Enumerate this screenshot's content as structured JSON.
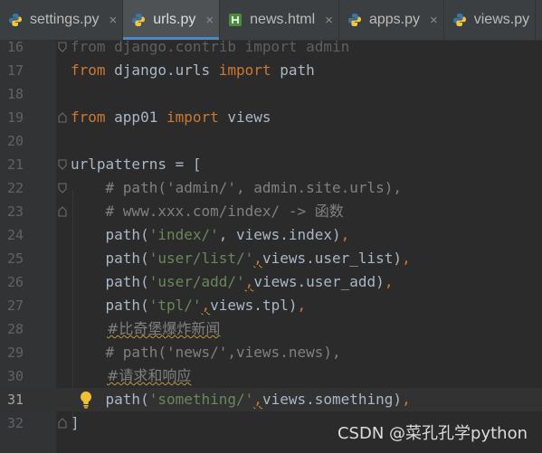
{
  "tabs": [
    {
      "label": "settings.py",
      "icon": "python-file-icon",
      "active": false
    },
    {
      "label": "urls.py",
      "icon": "python-file-icon",
      "active": true
    },
    {
      "label": "news.html",
      "icon": "html-file-icon",
      "active": false
    },
    {
      "label": "apps.py",
      "icon": "python-file-icon",
      "active": false
    },
    {
      "label": "views.py",
      "icon": "python-file-icon",
      "active": false
    }
  ],
  "tab_close_glyph": "×",
  "current_line": "31",
  "lines": {
    "l16": {
      "num": "16",
      "a": "from django.contrib import admin"
    },
    "l17": {
      "num": "17",
      "kw1": "from",
      "a": " django.urls ",
      "kw2": "import",
      "b": " path"
    },
    "l18": {
      "num": "18"
    },
    "l19": {
      "num": "19",
      "kw1": "from",
      "a": " app01 ",
      "kw2": "import",
      "b": " views"
    },
    "l20": {
      "num": "20"
    },
    "l21": {
      "num": "21",
      "a": "urlpatterns = ["
    },
    "l22": {
      "num": "22",
      "c": "    # path('admin/', admin.site.urls),"
    },
    "l23": {
      "num": "23",
      "c": "    # www.xxx.com/index/ -> 函数"
    },
    "l24": {
      "num": "24",
      "a": "    path(",
      "s": "'index/'",
      "b": ", views.index)",
      "p": ","
    },
    "l25": {
      "num": "25",
      "a": "    path(",
      "s": "'user/list/'",
      "q": ",",
      "b": "views.user_list)",
      "p": ","
    },
    "l26": {
      "num": "26",
      "a": "    path(",
      "s": "'user/add/'",
      "q": ",",
      "b": "views.user_add)",
      "p": ","
    },
    "l27": {
      "num": "27",
      "a": "    path(",
      "s": "'tpl/'",
      "q": ",",
      "b": "views.tpl)",
      "p": ","
    },
    "l28": {
      "num": "28",
      "c": "#比奇堡爆炸新闻"
    },
    "l29": {
      "num": "29",
      "c": "    # path('news/',views.news),"
    },
    "l30": {
      "num": "30",
      "c": "#请求和响应"
    },
    "l31": {
      "num": "31",
      "a": "    path(",
      "s": "'something/'",
      "q": ",",
      "b": "views.something)",
      "p": ","
    },
    "l32": {
      "num": "32",
      "a": "]"
    }
  },
  "watermark": "CSDN @菜孔孔学python",
  "colors": {
    "keyword": "#cc7832",
    "string": "#6a8759",
    "comment": "#808080",
    "text": "#a9b7c6",
    "background": "#2b2b2b",
    "gutter": "#313335",
    "tab_accent": "#4a88c7"
  }
}
